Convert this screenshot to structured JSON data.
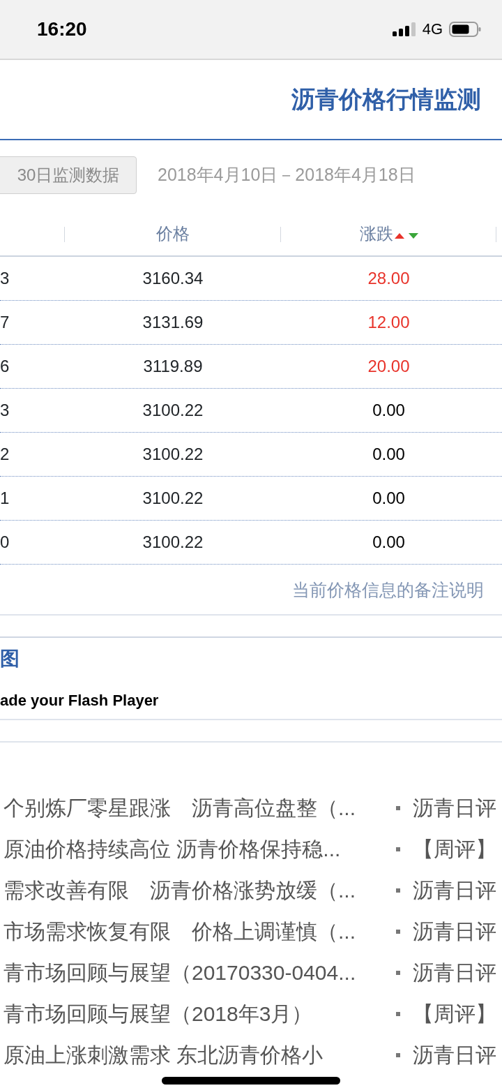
{
  "status_bar": {
    "time": "16:20",
    "network": "4G"
  },
  "header": {
    "title": "沥青价格行情监测"
  },
  "filter": {
    "button": "30日监测数据",
    "date_range": "2018年4月10日－2018年4月18日"
  },
  "table": {
    "columns": [
      {
        "label": "价格",
        "sortable": false
      },
      {
        "label": "涨跌",
        "sortable": true
      }
    ],
    "rows": [
      {
        "column_1": "3",
        "price": "3160.34",
        "change": "28.00",
        "rising": true
      },
      {
        "column_1": "7",
        "price": "3131.69",
        "change": "12.00",
        "rising": true
      },
      {
        "column_1": "6",
        "price": "3119.89",
        "change": "20.00",
        "rising": true
      },
      {
        "column_1": "3",
        "price": "3100.22",
        "change": "0.00",
        "rising": false
      },
      {
        "column_1": "2",
        "price": "3100.22",
        "change": "0.00",
        "rising": false
      },
      {
        "column_1": "1",
        "price": "3100.22",
        "change": "0.00",
        "rising": false
      },
      {
        "column_1": "0",
        "price": "3100.22",
        "change": "0.00",
        "rising": false
      }
    ]
  },
  "note_link": "当前价格信息的备注说明",
  "chart_section": {
    "title": "图",
    "message": "ade your Flash Player"
  },
  "news": [
    {
      "title": "个别炼厂零星跟涨　沥青高位盘整（...",
      "category": "沥青日评"
    },
    {
      "title": "原油价格持续高位 沥青价格保持稳...",
      "category": "【周评】"
    },
    {
      "title": "需求改善有限　沥青价格涨势放缓（...",
      "category": "沥青日评"
    },
    {
      "title": "市场需求恢复有限　价格上调谨慎（...",
      "category": "沥青日评"
    },
    {
      "title": "青市场回顾与展望（20170330-0404...",
      "category": "沥青日评"
    },
    {
      "title": "青市场回顾与展望（2018年3月）",
      "category": "【周评】"
    },
    {
      "title": "原油上涨刺激需求 东北沥青价格小",
      "category": "沥青日评"
    }
  ]
}
